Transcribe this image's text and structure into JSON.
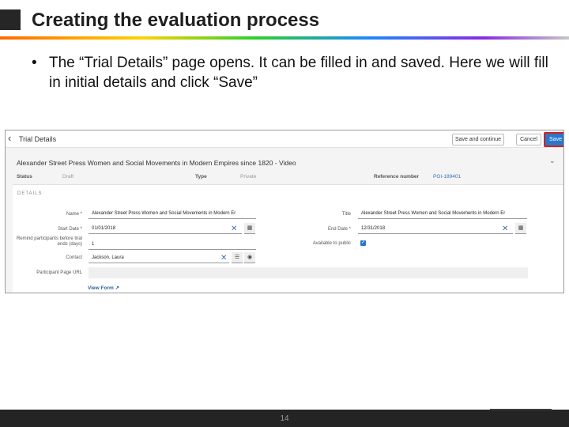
{
  "slide": {
    "title": "Creating the evaluation process",
    "bullet_symbol": "•",
    "bullet": "The “Trial Details” page opens.  It can be filled in and saved.  Here we will fill in initial details and click “Save”",
    "page_number": "14"
  },
  "app": {
    "page_title": "Trial Details",
    "back_icon": "chevron-left-icon",
    "buttons": {
      "save_and_continue": "Save and continue",
      "cancel": "Cancel",
      "save": "Save"
    },
    "record_title": "Alexander Street Press Women and Social Movements in Modern Empires since 1820 - Video",
    "info": {
      "status_label": "Status",
      "status_value": "Draft",
      "type_label": "Type",
      "type_value": "Private",
      "reference_label": "Reference number",
      "reference_value": "PGI-189401"
    },
    "section_label": "DETAILS",
    "fields": {
      "name_label": "Name *",
      "name_value": "Alexander Street Press Women and Social Movements in Modern Er",
      "title_label": "Title",
      "title_value": "Alexander Street Press Women and Social Movements in Modern Er",
      "start_date_label": "Start Date *",
      "start_date_value": "01/01/2018",
      "end_date_label": "End Date *",
      "end_date_value": "12/31/2018",
      "remind_label": "Remind participants before trial ends (days)",
      "remind_value": "1",
      "available_label": "Available to public",
      "available_checked": true,
      "contact_label": "Contact",
      "contact_value": "Jackson, Laura",
      "participant_url_label": "Participant Page URL",
      "participant_url_value": ""
    },
    "view_form": "View Form",
    "colors": {
      "save_button": "#2a78cc",
      "save_highlight": "#d42020",
      "link": "#2f5f99"
    }
  }
}
